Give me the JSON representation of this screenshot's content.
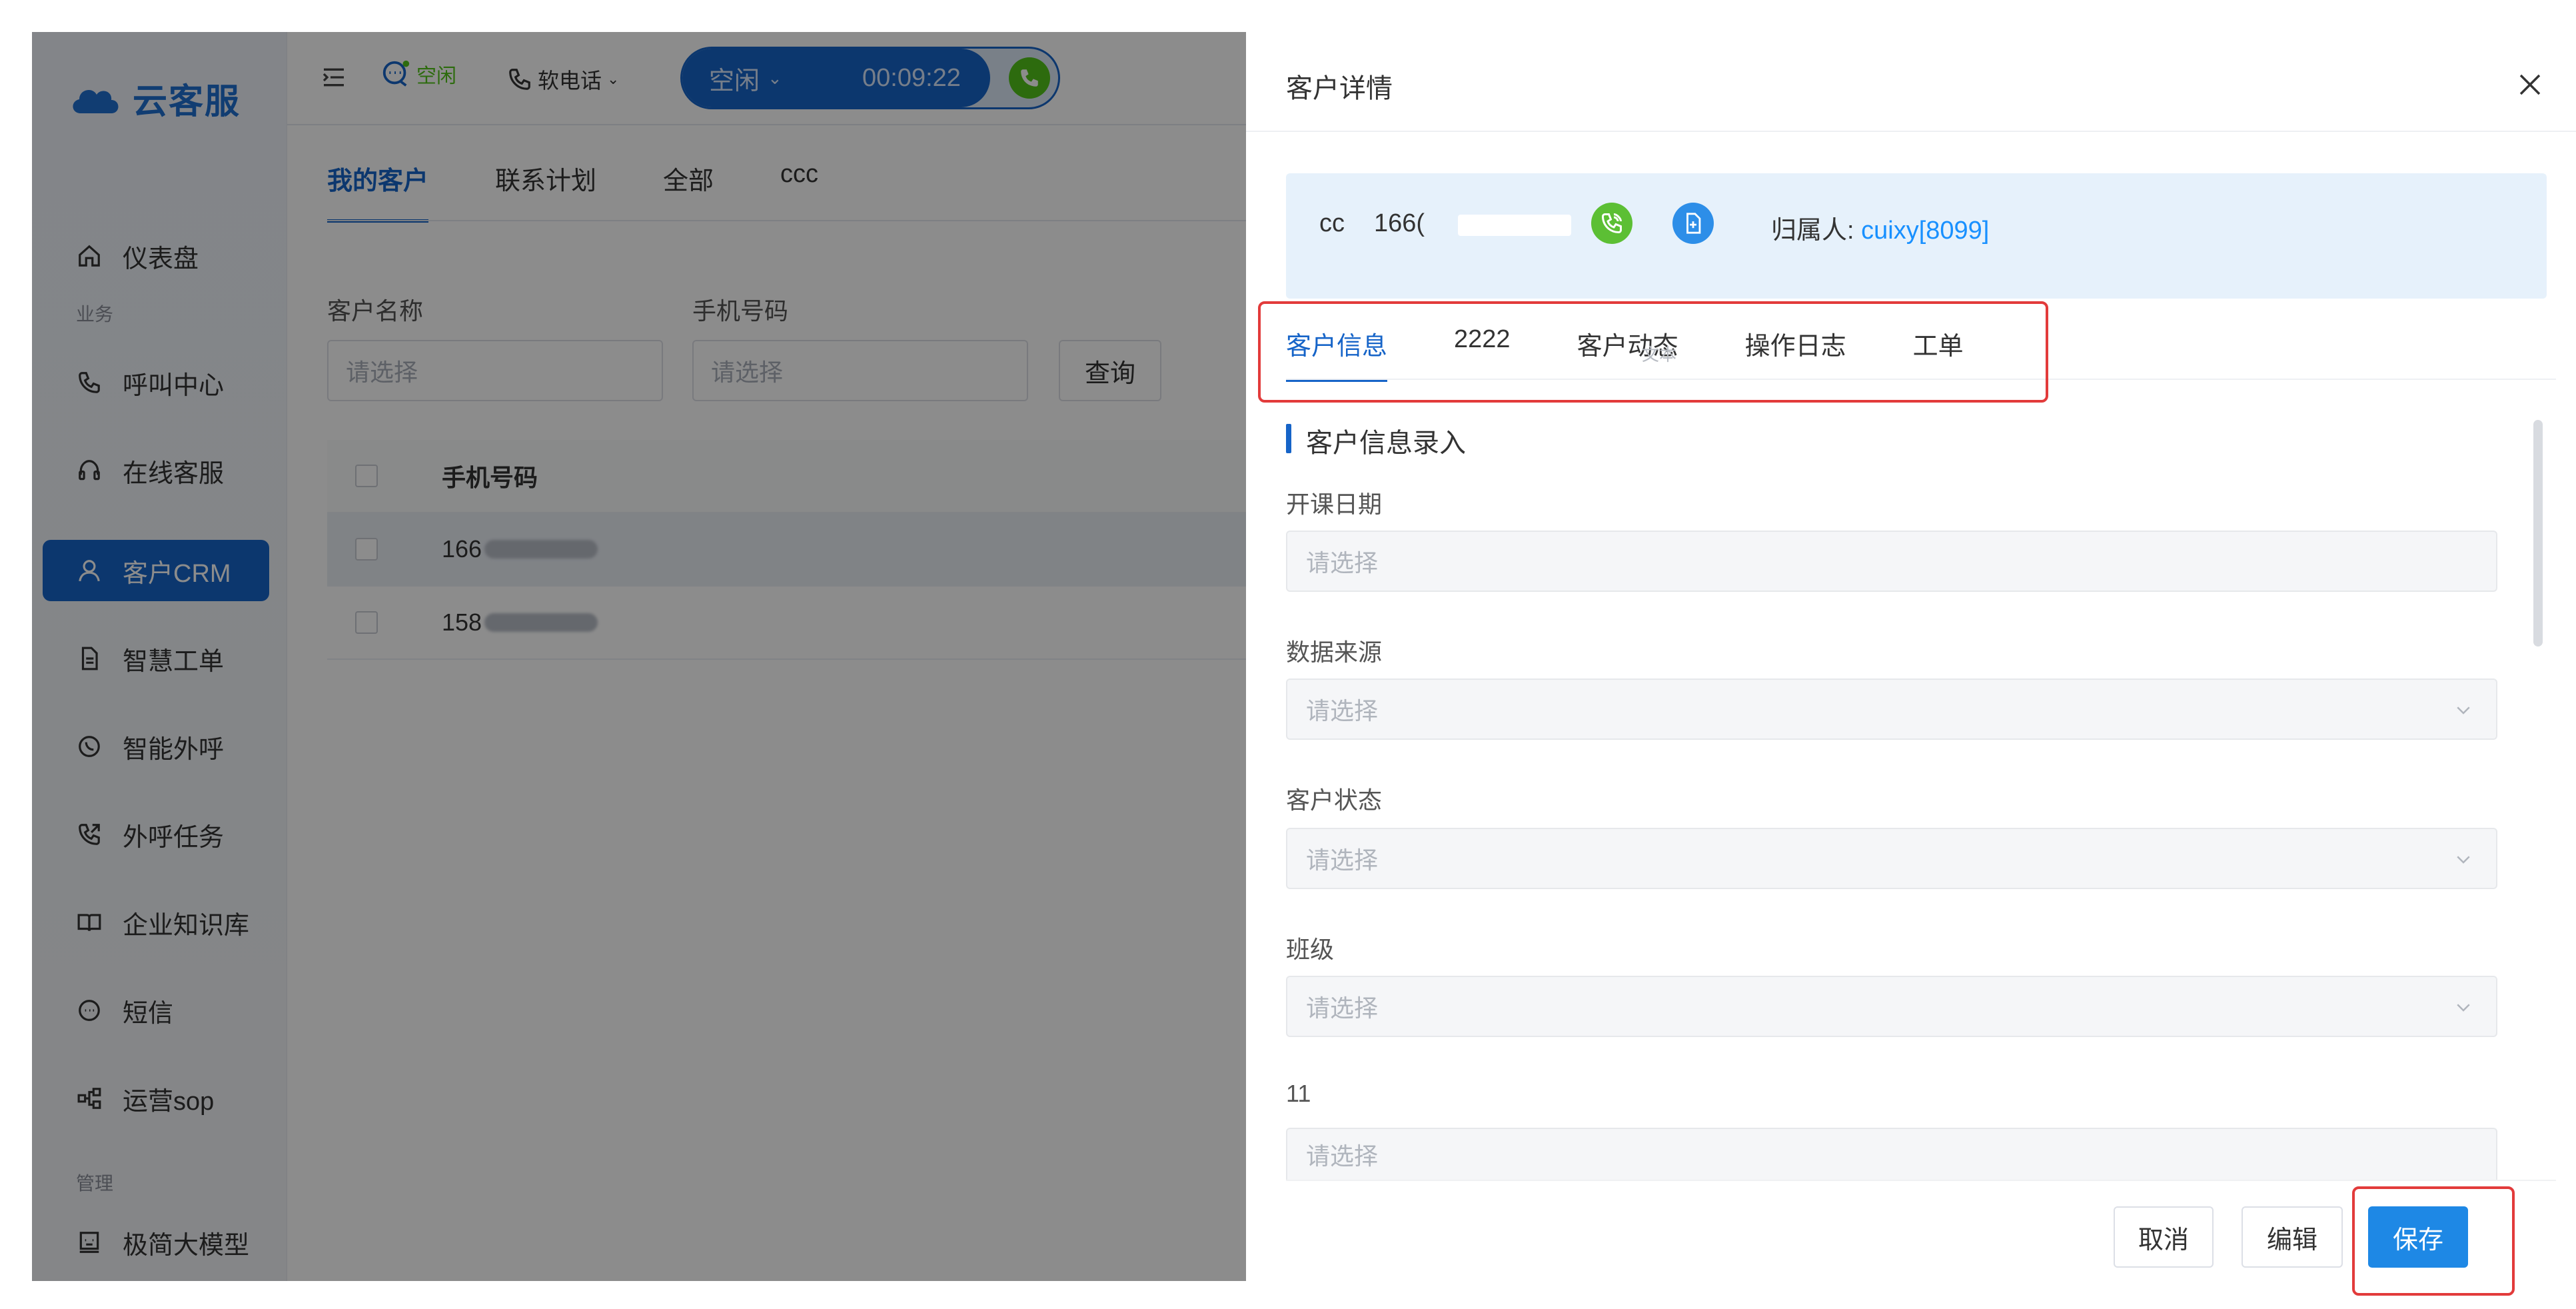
{
  "app": {
    "logo_text": "云客服"
  },
  "sidebar": {
    "items": [
      {
        "label": "仪表盘",
        "icon": "home-icon"
      },
      {
        "label": "呼叫中心",
        "icon": "phone-icon"
      },
      {
        "label": "在线客服",
        "icon": "headset-icon"
      },
      {
        "label": "客户CRM",
        "icon": "user-icon",
        "active": true
      },
      {
        "label": "智慧工单",
        "icon": "document-icon"
      },
      {
        "label": "智能外呼",
        "icon": "whatsapp-icon"
      },
      {
        "label": "外呼任务",
        "icon": "phone-outgoing-icon"
      },
      {
        "label": "企业知识库",
        "icon": "book-icon"
      },
      {
        "label": "短信",
        "icon": "sms-icon"
      },
      {
        "label": "运营sop",
        "icon": "flow-icon"
      },
      {
        "label": "极简大模型",
        "icon": "model-icon"
      }
    ],
    "groups": {
      "business": "业务",
      "manage": "管理"
    }
  },
  "topbar": {
    "status_mini": "空闲",
    "softphone": "软电话",
    "call_state": "空闲",
    "call_timer": "00:09:22"
  },
  "main": {
    "tabs": [
      {
        "label": "我的客户",
        "active": true
      },
      {
        "label": "联系计划"
      },
      {
        "label": "全部"
      },
      {
        "label": "ccc"
      }
    ],
    "filters": {
      "name_label": "客户名称",
      "name_placeholder": "请选择",
      "phone_label": "手机号码",
      "phone_placeholder": "请选择",
      "query_button": "查询"
    },
    "table": {
      "header": "手机号码",
      "rows": [
        "166",
        "158"
      ]
    }
  },
  "drawer": {
    "title": "客户详情",
    "customer": {
      "name": "cc",
      "phone_prefix": "166(",
      "owner_label": "归属人:",
      "owner_name": "cuixy[8099]"
    },
    "tabs": [
      {
        "label": "客户信息",
        "active": true
      },
      {
        "label": "2222"
      },
      {
        "label": "客户动态"
      },
      {
        "label": "操作日志"
      },
      {
        "label": "工单"
      }
    ],
    "ghost_text": "文本",
    "section_title": "客户信息录入",
    "fields": [
      {
        "label": "开课日期",
        "placeholder": "请选择",
        "dropdown": false
      },
      {
        "label": "数据来源",
        "placeholder": "请选择",
        "dropdown": true
      },
      {
        "label": "客户状态",
        "placeholder": "请选择",
        "dropdown": true
      },
      {
        "label": "班级",
        "placeholder": "请选择",
        "dropdown": true
      },
      {
        "label": "11",
        "placeholder": "请选择",
        "dropdown": false
      }
    ],
    "buttons": {
      "cancel": "取消",
      "edit": "编辑",
      "save": "保存"
    }
  },
  "colors": {
    "primary": "#1664c8",
    "link": "#1890ff",
    "success": "#52c41a",
    "highlight_border": "#e23b3b"
  }
}
